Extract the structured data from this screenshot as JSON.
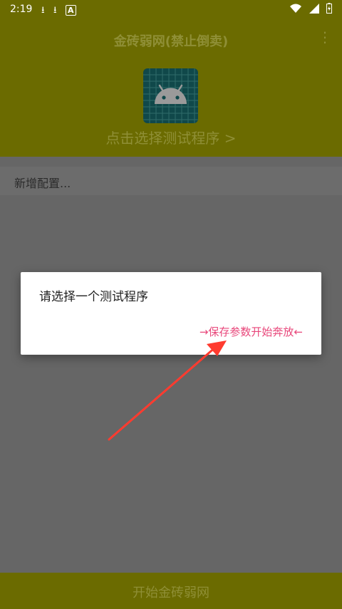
{
  "status_bar": {
    "time": "2:19",
    "left_icons": [
      "download-icon",
      "download-icon",
      "a-icon"
    ],
    "right_icons": [
      "wifi-icon",
      "signal-icon",
      "battery-icon"
    ]
  },
  "header": {
    "title": "金砖弱网(禁止倒卖)",
    "menu_icon": "more-vert-icon",
    "select_program": "点击选择测试程序 >"
  },
  "config": {
    "label": "新增配置..."
  },
  "dialog": {
    "message": "请选择一个测试程序",
    "button": "→保存参数开始奔放←"
  },
  "bottom": {
    "label": "开始金砖弱网"
  },
  "colors": {
    "appbar": "#6b6b00",
    "muted_text": "#8f8f36",
    "accent": "#e8467a",
    "arrow": "#ff3b2f",
    "scrim": "#666666"
  }
}
